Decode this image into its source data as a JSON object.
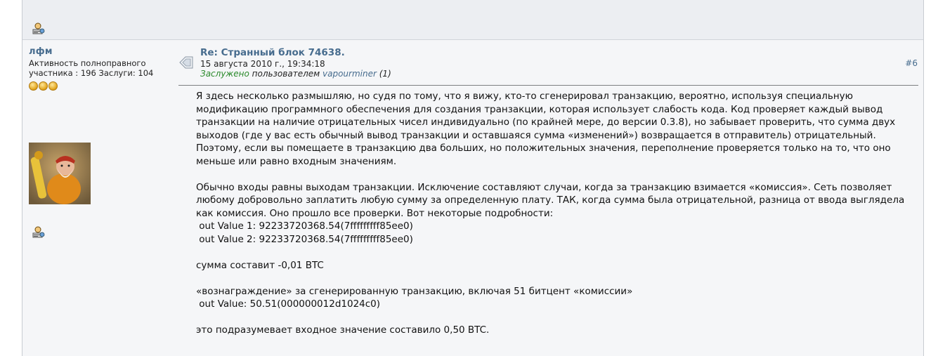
{
  "poster": {
    "name": "лфм",
    "rank": "Активность полноправного участника : 196 Заслуги: 104",
    "stars": 3
  },
  "post": {
    "title": "Re: Странный блок 74638.",
    "date": "15 августа 2010 г., 19:34:18",
    "merit_label": "Заслужено",
    "merit_by": "пользователем",
    "merit_user": "vapourminer",
    "merit_count": "(1)",
    "number": "#6",
    "body": "Я здесь несколько размышляю, но судя по тому, что я вижу, кто-то сгенерировал транзакцию, вероятно, используя специальную модификацию программного обеспечения для создания транзакции, которая использует слабость кода. Код проверяет каждый вывод транзакции на наличие отрицательных чисел индивидуально (по крайней мере, до версии 0.3.8), но забывает проверить, что сумма двух выходов (где у вас есть обычный вывод транзакции и оставшаяся сумма «изменений») возвращается в отправитель) отрицательный. Поэтому, если вы помещаете в транзакцию два больших, но положительных значения, переполнение проверяется только на то, что оно меньше или равно входным значениям.\n\nОбычно входы равны выходам транзакции. Исключение составляют случаи, когда за транзакцию взимается «комиссия». Сеть позволяет любому добровольно заплатить любую сумму за определенную плату. ТАК, когда сумма была отрицательной, разница от ввода выглядела как комиссия. Оно прошло все проверки. Вот некоторые подробности:\n out Value 1: 92233720368.54(7fffffffff85ee0)\n out Value 2: 92233720368.54(7fffffffff85ee0)\n\nсумма составит -0,01 BTC\n\n«вознаграждение» за сгенерированную транзакцию, включая 51 битцент «комиссии»\n out Value: 50.51(000000012d1024c0)\n\nэто подразумевает входное значение составило 0,50 BTC."
  },
  "icons": {
    "profile": "profile-icon",
    "post": "post-icon",
    "avatar": "avatar-image"
  },
  "colors": {
    "link": "#476c8e",
    "merit": "#2b8a2b",
    "background": "#f5f6f8"
  }
}
